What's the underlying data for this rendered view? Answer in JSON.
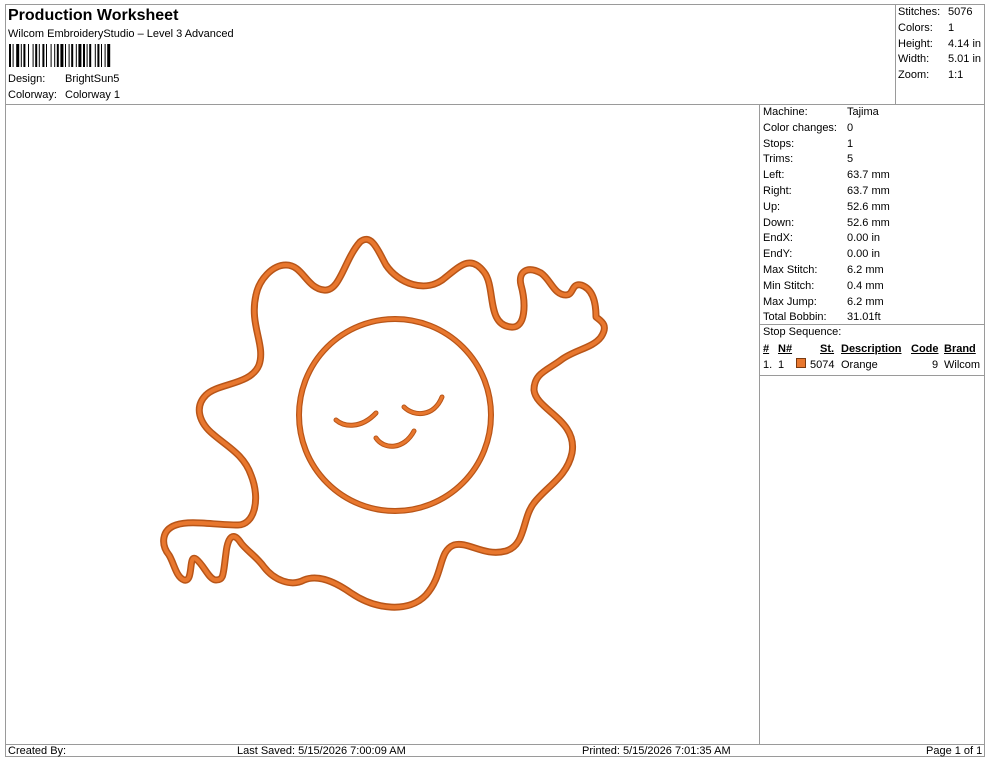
{
  "header": {
    "title": "Production Worksheet",
    "subtitle": "Wilcom EmbroideryStudio – Level 3 Advanced",
    "design_label": "Design:",
    "design_value": "BrightSun5",
    "colorway_label": "Colorway:",
    "colorway_value": "Colorway 1"
  },
  "summary": [
    {
      "label": "Stitches:",
      "value": "5076"
    },
    {
      "label": "Colors:",
      "value": "1"
    },
    {
      "label": "Height:",
      "value": "4.14 in"
    },
    {
      "label": "Width:",
      "value": "5.01 in"
    },
    {
      "label": "Zoom:",
      "value": "1:1"
    }
  ],
  "machine_info": [
    {
      "label": "Machine:",
      "value": "Tajima"
    },
    {
      "label": "Color changes:",
      "value": "0"
    },
    {
      "label": "Stops:",
      "value": "1"
    },
    {
      "label": "Trims:",
      "value": "5"
    },
    {
      "label": "Left:",
      "value": "63.7 mm"
    },
    {
      "label": "Right:",
      "value": "63.7 mm"
    },
    {
      "label": "Up:",
      "value": "52.6 mm"
    },
    {
      "label": "Down:",
      "value": "52.6 mm"
    },
    {
      "label": "EndX:",
      "value": "0.00 in"
    },
    {
      "label": "EndY:",
      "value": "0.00 in"
    },
    {
      "label": "Max Stitch:",
      "value": "6.2 mm"
    },
    {
      "label": "Min Stitch:",
      "value": "0.4 mm"
    },
    {
      "label": "Max Jump:",
      "value": "6.2 mm"
    },
    {
      "label": "Total Bobbin:",
      "value": "31.01ft"
    }
  ],
  "stop_sequence": {
    "label": "Stop Sequence:",
    "headers": {
      "num": "#",
      "n": "N#",
      "st": "St.",
      "description": "Description",
      "code": "Code",
      "brand": "Brand"
    },
    "rows": [
      {
        "num": "1.",
        "n": "1",
        "st": "5074",
        "description": "Orange",
        "code": "9",
        "brand": "Wilcom",
        "color": "#e8772e"
      }
    ]
  },
  "footer": {
    "created_by": "Created By:",
    "last_saved": "Last Saved: 5/15/2026 7:00:09 AM",
    "printed": "Printed: 5/15/2026 7:01:35 AM",
    "page": "Page 1 of 1"
  },
  "design_colors": {
    "thread": "#e8772e",
    "thread_dark": "#b85518"
  }
}
